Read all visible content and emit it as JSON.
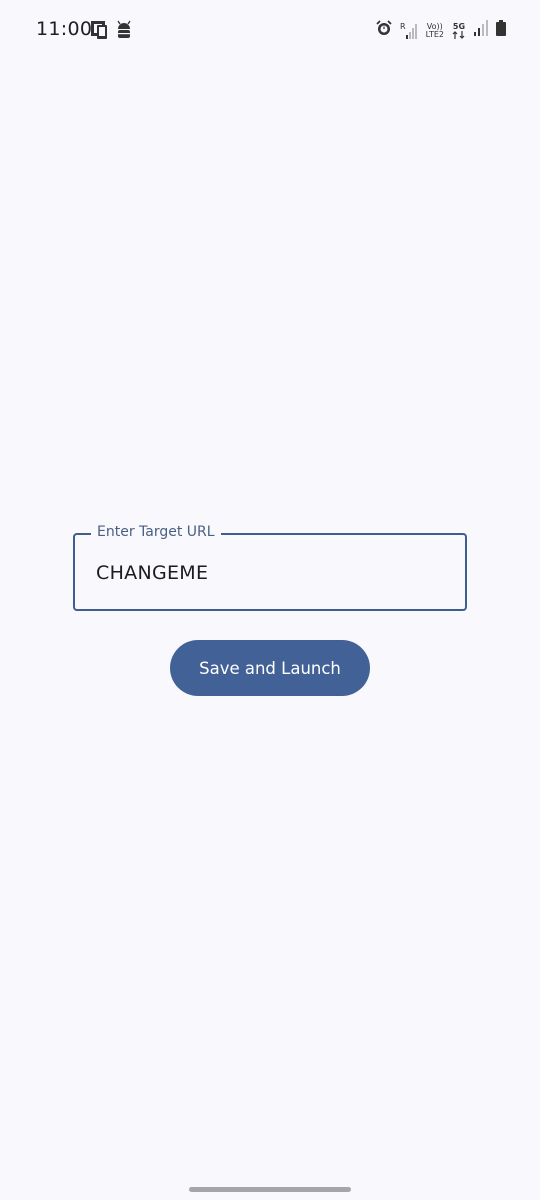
{
  "status_bar": {
    "time": "11:00",
    "left_icons": [
      "screen-cast-icon",
      "android-debug-icon"
    ],
    "right_icons": [
      "alarm-icon",
      "roaming-signal-icon",
      "volte-icon",
      "5g-icon",
      "signal-icon",
      "battery-icon"
    ],
    "roaming_label": "R",
    "volte_label_top": "Vo))",
    "volte_label_bottom": "LTE2",
    "network_label": "5G"
  },
  "form": {
    "url_label": "Enter Target URL",
    "url_value": "CHANGEME",
    "button_label": "Save and Launch"
  },
  "colors": {
    "background": "#f8f8fd",
    "accent": "#426196",
    "outline": "#3f5e8f"
  }
}
